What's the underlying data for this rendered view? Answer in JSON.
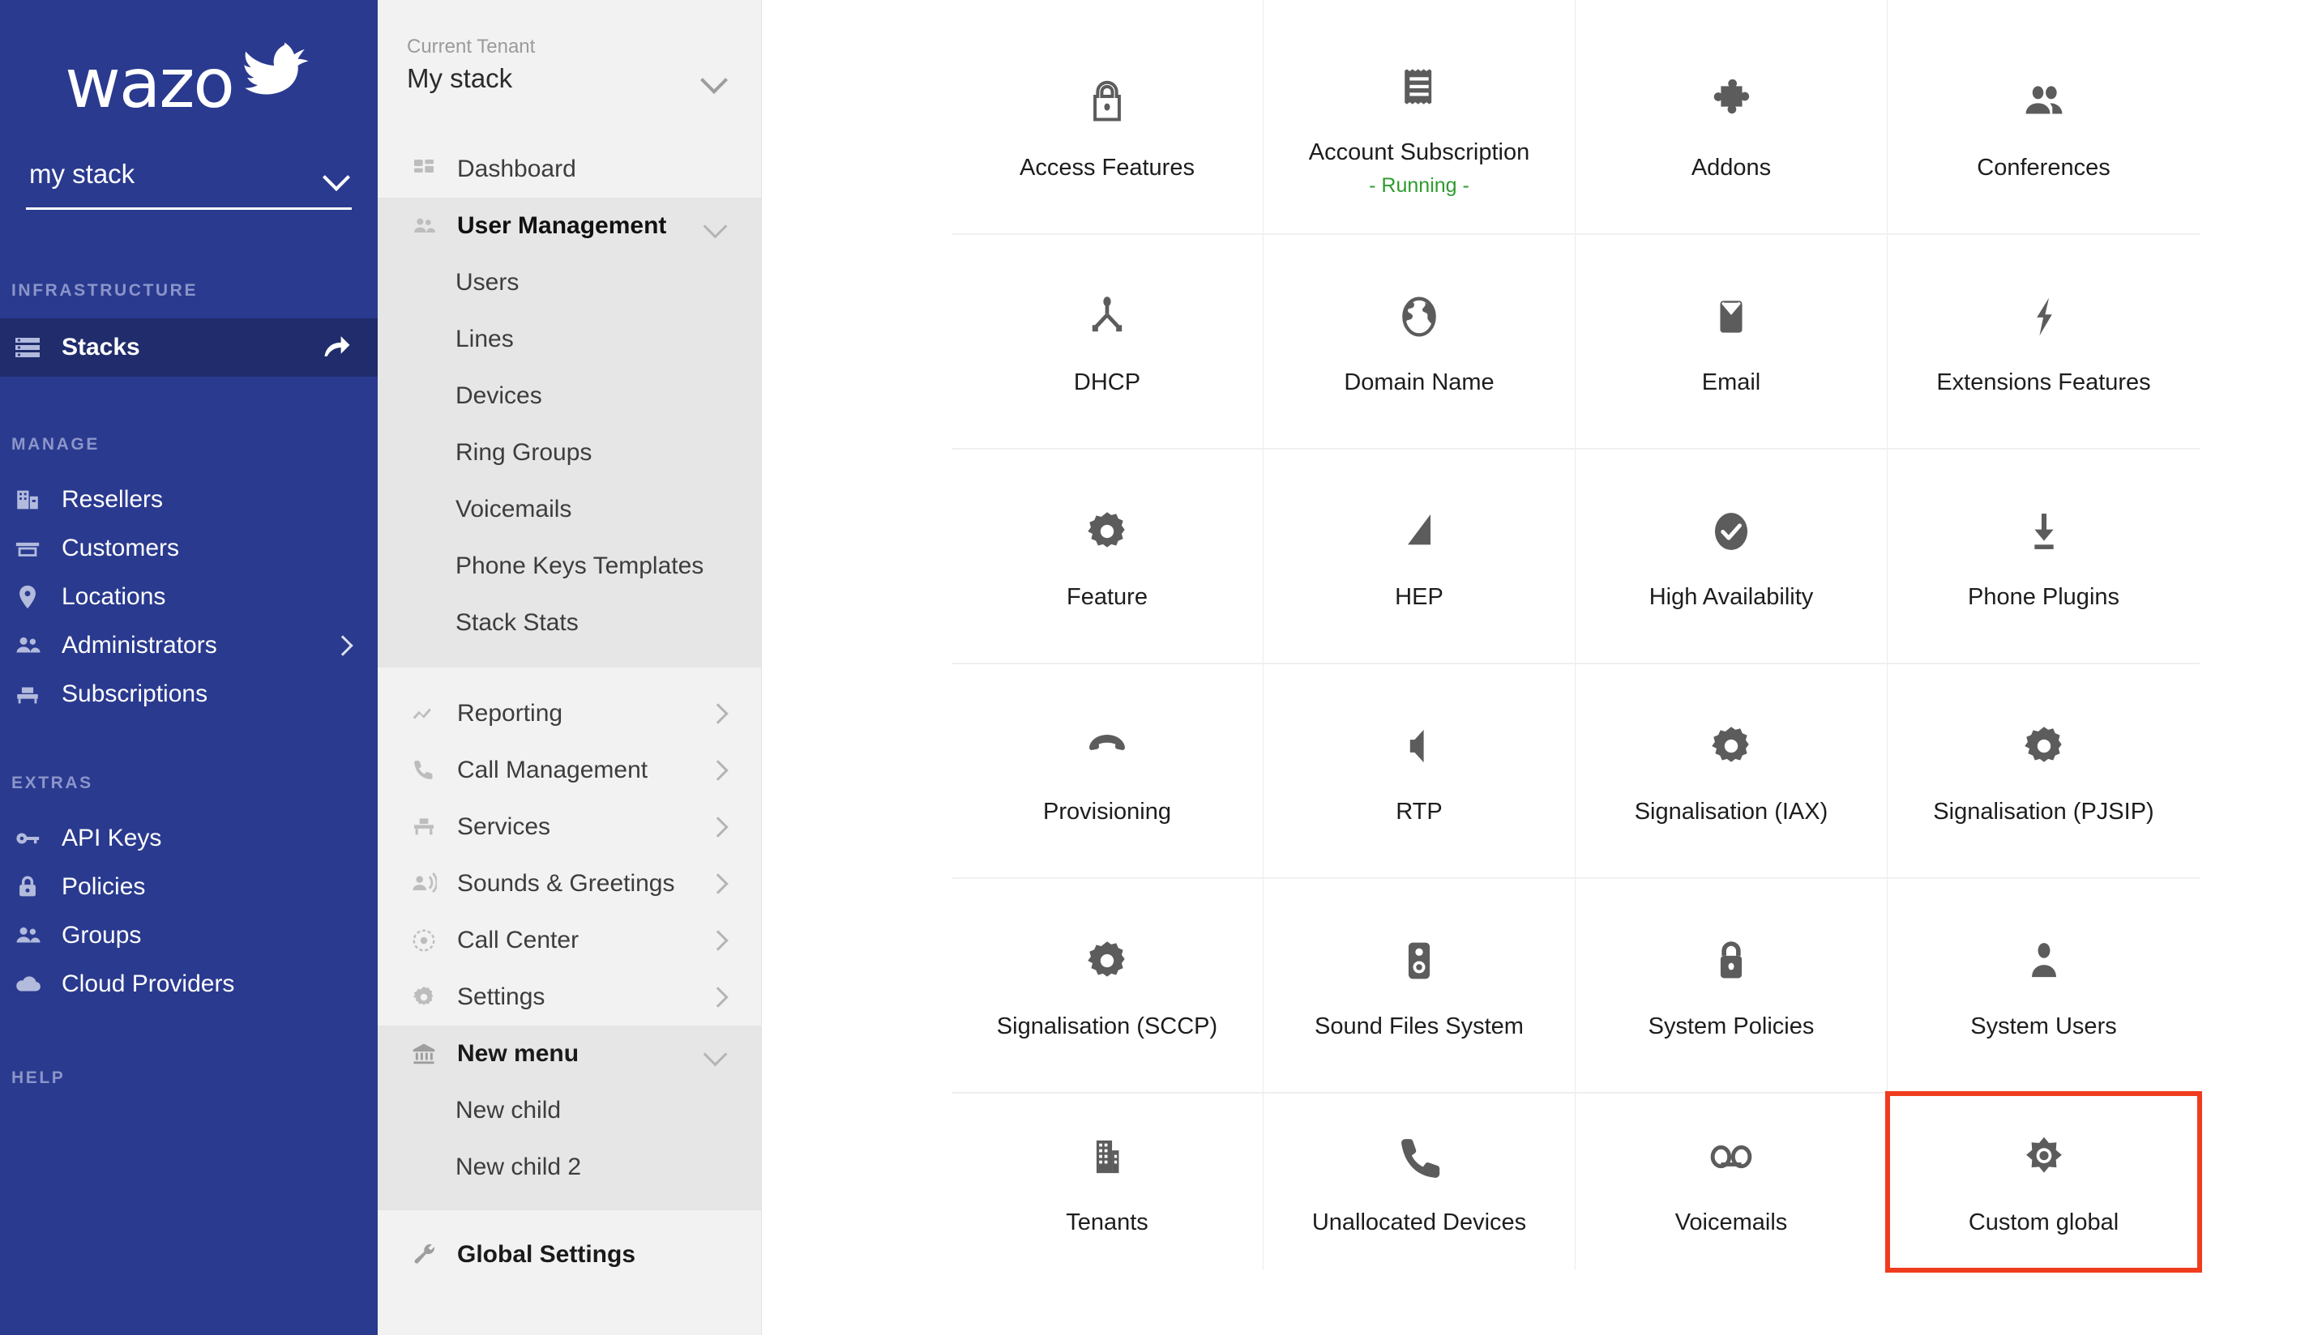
{
  "brand": {
    "name": "wazo",
    "bird_icon": "bird-logo-icon"
  },
  "primary_nav": {
    "stack_selector": {
      "value": "my stack",
      "chevron_icon": "chevron-down-icon"
    },
    "sections": [
      {
        "label": "INFRASTRUCTURE",
        "items": [
          {
            "label": "Stacks",
            "icon": "server-stack-icon",
            "active": true,
            "trailing_icon": "refresh-icon"
          }
        ]
      },
      {
        "label": "MANAGE",
        "items": [
          {
            "label": "Resellers",
            "icon": "building-store-icon",
            "active": false,
            "trailing_icon": ""
          },
          {
            "label": "Customers",
            "icon": "storefront-icon",
            "active": false,
            "trailing_icon": ""
          },
          {
            "label": "Locations",
            "icon": "map-pin-icon",
            "active": false,
            "trailing_icon": ""
          },
          {
            "label": "Administrators",
            "icon": "people-icon",
            "active": false,
            "trailing_icon": "chevron-right-icon"
          },
          {
            "label": "Subscriptions",
            "icon": "subscription-icon",
            "active": false,
            "trailing_icon": ""
          }
        ]
      },
      {
        "label": "EXTRAS",
        "items": [
          {
            "label": "API Keys",
            "icon": "key-icon",
            "active": false,
            "trailing_icon": ""
          },
          {
            "label": "Policies",
            "icon": "lock-icon",
            "active": false,
            "trailing_icon": ""
          },
          {
            "label": "Groups",
            "icon": "people-icon",
            "active": false,
            "trailing_icon": ""
          },
          {
            "label": "Cloud Providers",
            "icon": "cloud-icon",
            "active": false,
            "trailing_icon": ""
          }
        ]
      },
      {
        "label": "HELP",
        "items": []
      }
    ]
  },
  "secondary_nav": {
    "tenant_caption": "Current Tenant",
    "tenant_name": "My stack",
    "tenant_chevron_icon": "chevron-down-icon",
    "items": [
      {
        "label": "Dashboard",
        "icon": "dashboard-icon",
        "type": "link",
        "state": ""
      },
      {
        "label": "User Management",
        "icon": "people-icon",
        "type": "group",
        "state": "open",
        "trailing_icon": "chevron-down-icon",
        "children": [
          "Users",
          "Lines",
          "Devices",
          "Ring Groups",
          "Voicemails",
          "Phone Keys Templates",
          "Stack Stats"
        ]
      },
      {
        "label": "Reporting",
        "icon": "trend-line-icon",
        "type": "group",
        "state": "closed",
        "trailing_icon": "chevron-right-icon",
        "children": []
      },
      {
        "label": "Call Management",
        "icon": "phone-icon",
        "type": "group",
        "state": "closed",
        "trailing_icon": "chevron-right-icon",
        "children": []
      },
      {
        "label": "Services",
        "icon": "services-icon",
        "type": "group",
        "state": "closed",
        "trailing_icon": "chevron-right-icon",
        "children": []
      },
      {
        "label": "Sounds & Greetings",
        "icon": "announcement-icon",
        "type": "group",
        "state": "closed",
        "trailing_icon": "chevron-right-icon",
        "children": []
      },
      {
        "label": "Call Center",
        "icon": "target-icon",
        "type": "group",
        "state": "closed",
        "trailing_icon": "chevron-right-icon",
        "children": []
      },
      {
        "label": "Settings",
        "icon": "gear-icon",
        "type": "group",
        "state": "closed",
        "trailing_icon": "chevron-right-icon",
        "children": []
      },
      {
        "label": "New menu",
        "icon": "bank-icon",
        "type": "group",
        "state": "open",
        "trailing_icon": "chevron-down-icon",
        "children": [
          "New child",
          "New child 2"
        ]
      },
      {
        "label": "Global Settings",
        "icon": "wrench-icon",
        "type": "link",
        "state": ""
      }
    ]
  },
  "main_grid": {
    "highlight_color": "#f03c1e",
    "status_color": "#2e9b2e",
    "cells": [
      {
        "label": "Access Features",
        "icon": "lock-icon",
        "status": "",
        "highlighted": false
      },
      {
        "label": "Account Subscription",
        "icon": "receipt-icon",
        "status": "- Running -",
        "highlighted": false
      },
      {
        "label": "Addons",
        "icon": "puzzle-piece-icon",
        "status": "",
        "highlighted": false
      },
      {
        "label": "Conferences",
        "icon": "people-icon",
        "status": "",
        "highlighted": false
      },
      {
        "label": "DHCP",
        "icon": "network-node-icon",
        "status": "",
        "highlighted": false
      },
      {
        "label": "Domain Name",
        "icon": "globe-icon",
        "status": "",
        "highlighted": false
      },
      {
        "label": "Email",
        "icon": "envelope-icon",
        "status": "",
        "highlighted": false
      },
      {
        "label": "Extensions Features",
        "icon": "lightning-bolt-icon",
        "status": "",
        "highlighted": false
      },
      {
        "label": "Feature",
        "icon": "gear-icon",
        "status": "",
        "highlighted": false
      },
      {
        "label": "HEP",
        "icon": "triangle-signal-icon",
        "status": "",
        "highlighted": false
      },
      {
        "label": "High Availability",
        "icon": "check-circle-icon",
        "status": "",
        "highlighted": false
      },
      {
        "label": "Phone Plugins",
        "icon": "download-icon",
        "status": "",
        "highlighted": false
      },
      {
        "label": "Provisioning",
        "icon": "phone-hangup-icon",
        "status": "",
        "highlighted": false
      },
      {
        "label": "RTP",
        "icon": "volume-icon",
        "status": "",
        "highlighted": false
      },
      {
        "label": "Signalisation (IAX)",
        "icon": "gear-icon",
        "status": "",
        "highlighted": false
      },
      {
        "label": "Signalisation (PJSIP)",
        "icon": "gear-icon",
        "status": "",
        "highlighted": false
      },
      {
        "label": "Signalisation (SCCP)",
        "icon": "gear-icon",
        "status": "",
        "highlighted": false
      },
      {
        "label": "Sound Files System",
        "icon": "speaker-icon",
        "status": "",
        "highlighted": false
      },
      {
        "label": "System Policies",
        "icon": "lock-filled-icon",
        "status": "",
        "highlighted": false
      },
      {
        "label": "System Users",
        "icon": "person-icon",
        "status": "",
        "highlighted": false
      },
      {
        "label": "Tenants",
        "icon": "building-icon",
        "status": "",
        "highlighted": false
      },
      {
        "label": "Unallocated Devices",
        "icon": "phone-icon",
        "status": "",
        "highlighted": false
      },
      {
        "label": "Voicemails",
        "icon": "voicemail-icon",
        "status": "",
        "highlighted": false
      },
      {
        "label": "Custom global",
        "icon": "brightness-sun-icon",
        "status": "",
        "highlighted": true
      }
    ]
  }
}
